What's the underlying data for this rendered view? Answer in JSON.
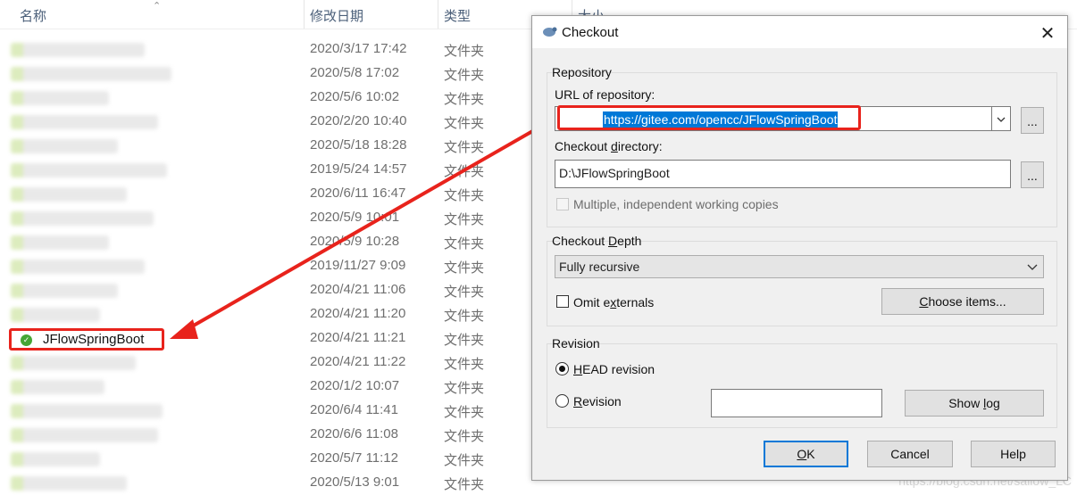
{
  "explorer": {
    "headers": {
      "name": "名称",
      "modified": "修改日期",
      "type": "类型",
      "size": "大小"
    },
    "rows": [
      {
        "date": "2020/3/17 17:42",
        "type": "文件夹"
      },
      {
        "date": "2020/5/8 17:02",
        "type": "文件夹"
      },
      {
        "date": "2020/5/6 10:02",
        "type": "文件夹"
      },
      {
        "date": "2020/2/20 10:40",
        "type": "文件夹"
      },
      {
        "date": "2020/5/18 18:28",
        "type": "文件夹"
      },
      {
        "date": "2019/5/24 14:57",
        "type": "文件夹"
      },
      {
        "date": "2020/6/11 16:47",
        "type": "文件夹"
      },
      {
        "date": "2020/5/9 10:01",
        "type": "文件夹"
      },
      {
        "date": "2020/5/9 10:28",
        "type": "文件夹"
      },
      {
        "date": "2019/11/27 9:09",
        "type": "文件夹"
      },
      {
        "date": "2020/4/21 11:06",
        "type": "文件夹"
      },
      {
        "date": "2020/4/21 11:20",
        "type": "文件夹"
      },
      {
        "date": "2020/4/21 11:21",
        "type": "文件夹",
        "name": "JFlowSpringBoot"
      },
      {
        "date": "2020/4/21 11:22",
        "type": "文件夹"
      },
      {
        "date": "2020/1/2 10:07",
        "type": "文件夹"
      },
      {
        "date": "2020/6/4 11:41",
        "type": "文件夹"
      },
      {
        "date": "2020/6/6 11:08",
        "type": "文件夹"
      },
      {
        "date": "2020/5/7 11:12",
        "type": "文件夹"
      },
      {
        "date": "2020/5/13 9:01",
        "type": "文件夹"
      }
    ],
    "highlighted_folder": "JFlowSpringBoot",
    "watermark": "https://blog.csdn.net/sallow_LC"
  },
  "dialog": {
    "title": "Checkout",
    "repository": {
      "group_label": "Repository",
      "url_label": "URL of repository:",
      "url_value": "https://gitee.com/opencc/JFlowSpringBoot",
      "browse_label": "...",
      "dir_label": "Checkout directory:",
      "dir_value": "D:\\JFlowSpringBoot",
      "dir_browse_label": "...",
      "multiple_label": "Multiple, independent working copies"
    },
    "depth": {
      "group_label": "Checkout Depth",
      "selected": "Fully recursive",
      "omit_label": "Omit externals",
      "choose_label": "Choose items..."
    },
    "revision": {
      "group_label": "Revision",
      "head_label": "HEAD revision",
      "revision_label": "Revision",
      "revision_value": "",
      "show_log_label": "Show log"
    },
    "buttons": {
      "ok": "OK",
      "cancel": "Cancel",
      "help": "Help"
    }
  },
  "colors": {
    "highlight_red": "#e8231c",
    "selection_blue": "#0078d7",
    "dialog_bg": "#f0f0f0"
  }
}
